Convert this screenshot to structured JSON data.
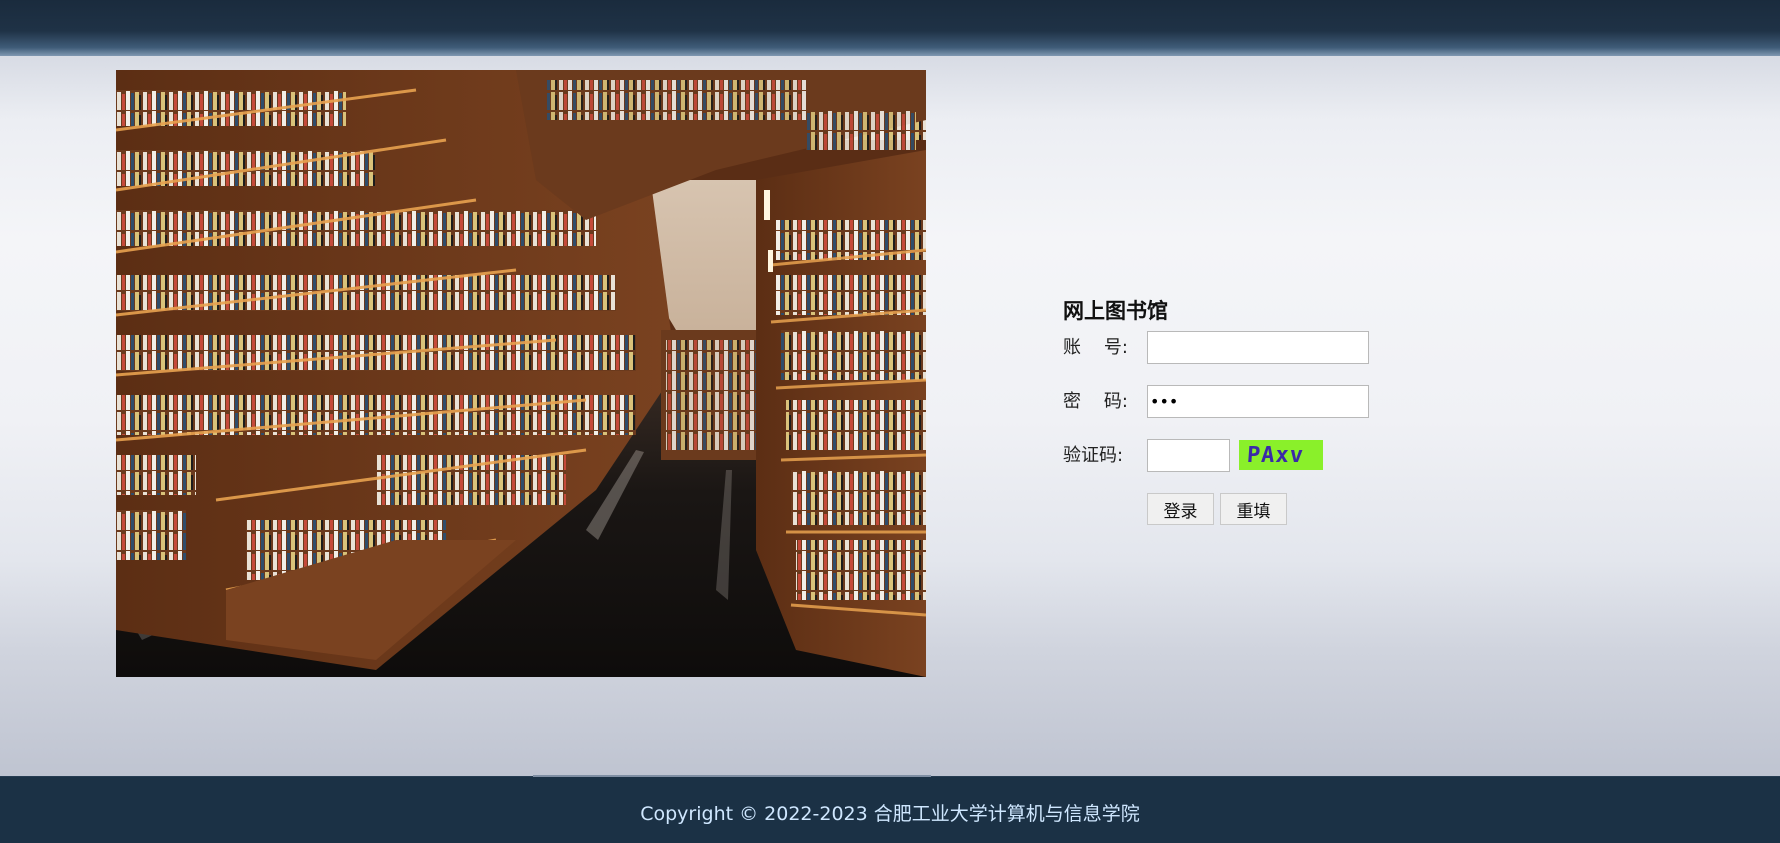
{
  "login": {
    "title": "网上图书馆",
    "account_label": "账    号:",
    "account_value": "",
    "password_label": "密    码:",
    "password_value": "•••",
    "captcha_label": "验证码:",
    "captcha_value": "",
    "captcha_image_text": "PAxv",
    "login_button": "登录",
    "reset_button": "重填"
  },
  "hero": {
    "image_icon": "bookstore-image"
  },
  "footer": {
    "copyright": "Copyright © 2022-2023 合肥工业大学计算机与信息学院"
  },
  "colors": {
    "header": "#1f3246",
    "footer": "#1b3145",
    "footer_text": "#cfe7ff",
    "captcha_bg": "#8af02a",
    "captcha_text": "#3b2aa8"
  }
}
